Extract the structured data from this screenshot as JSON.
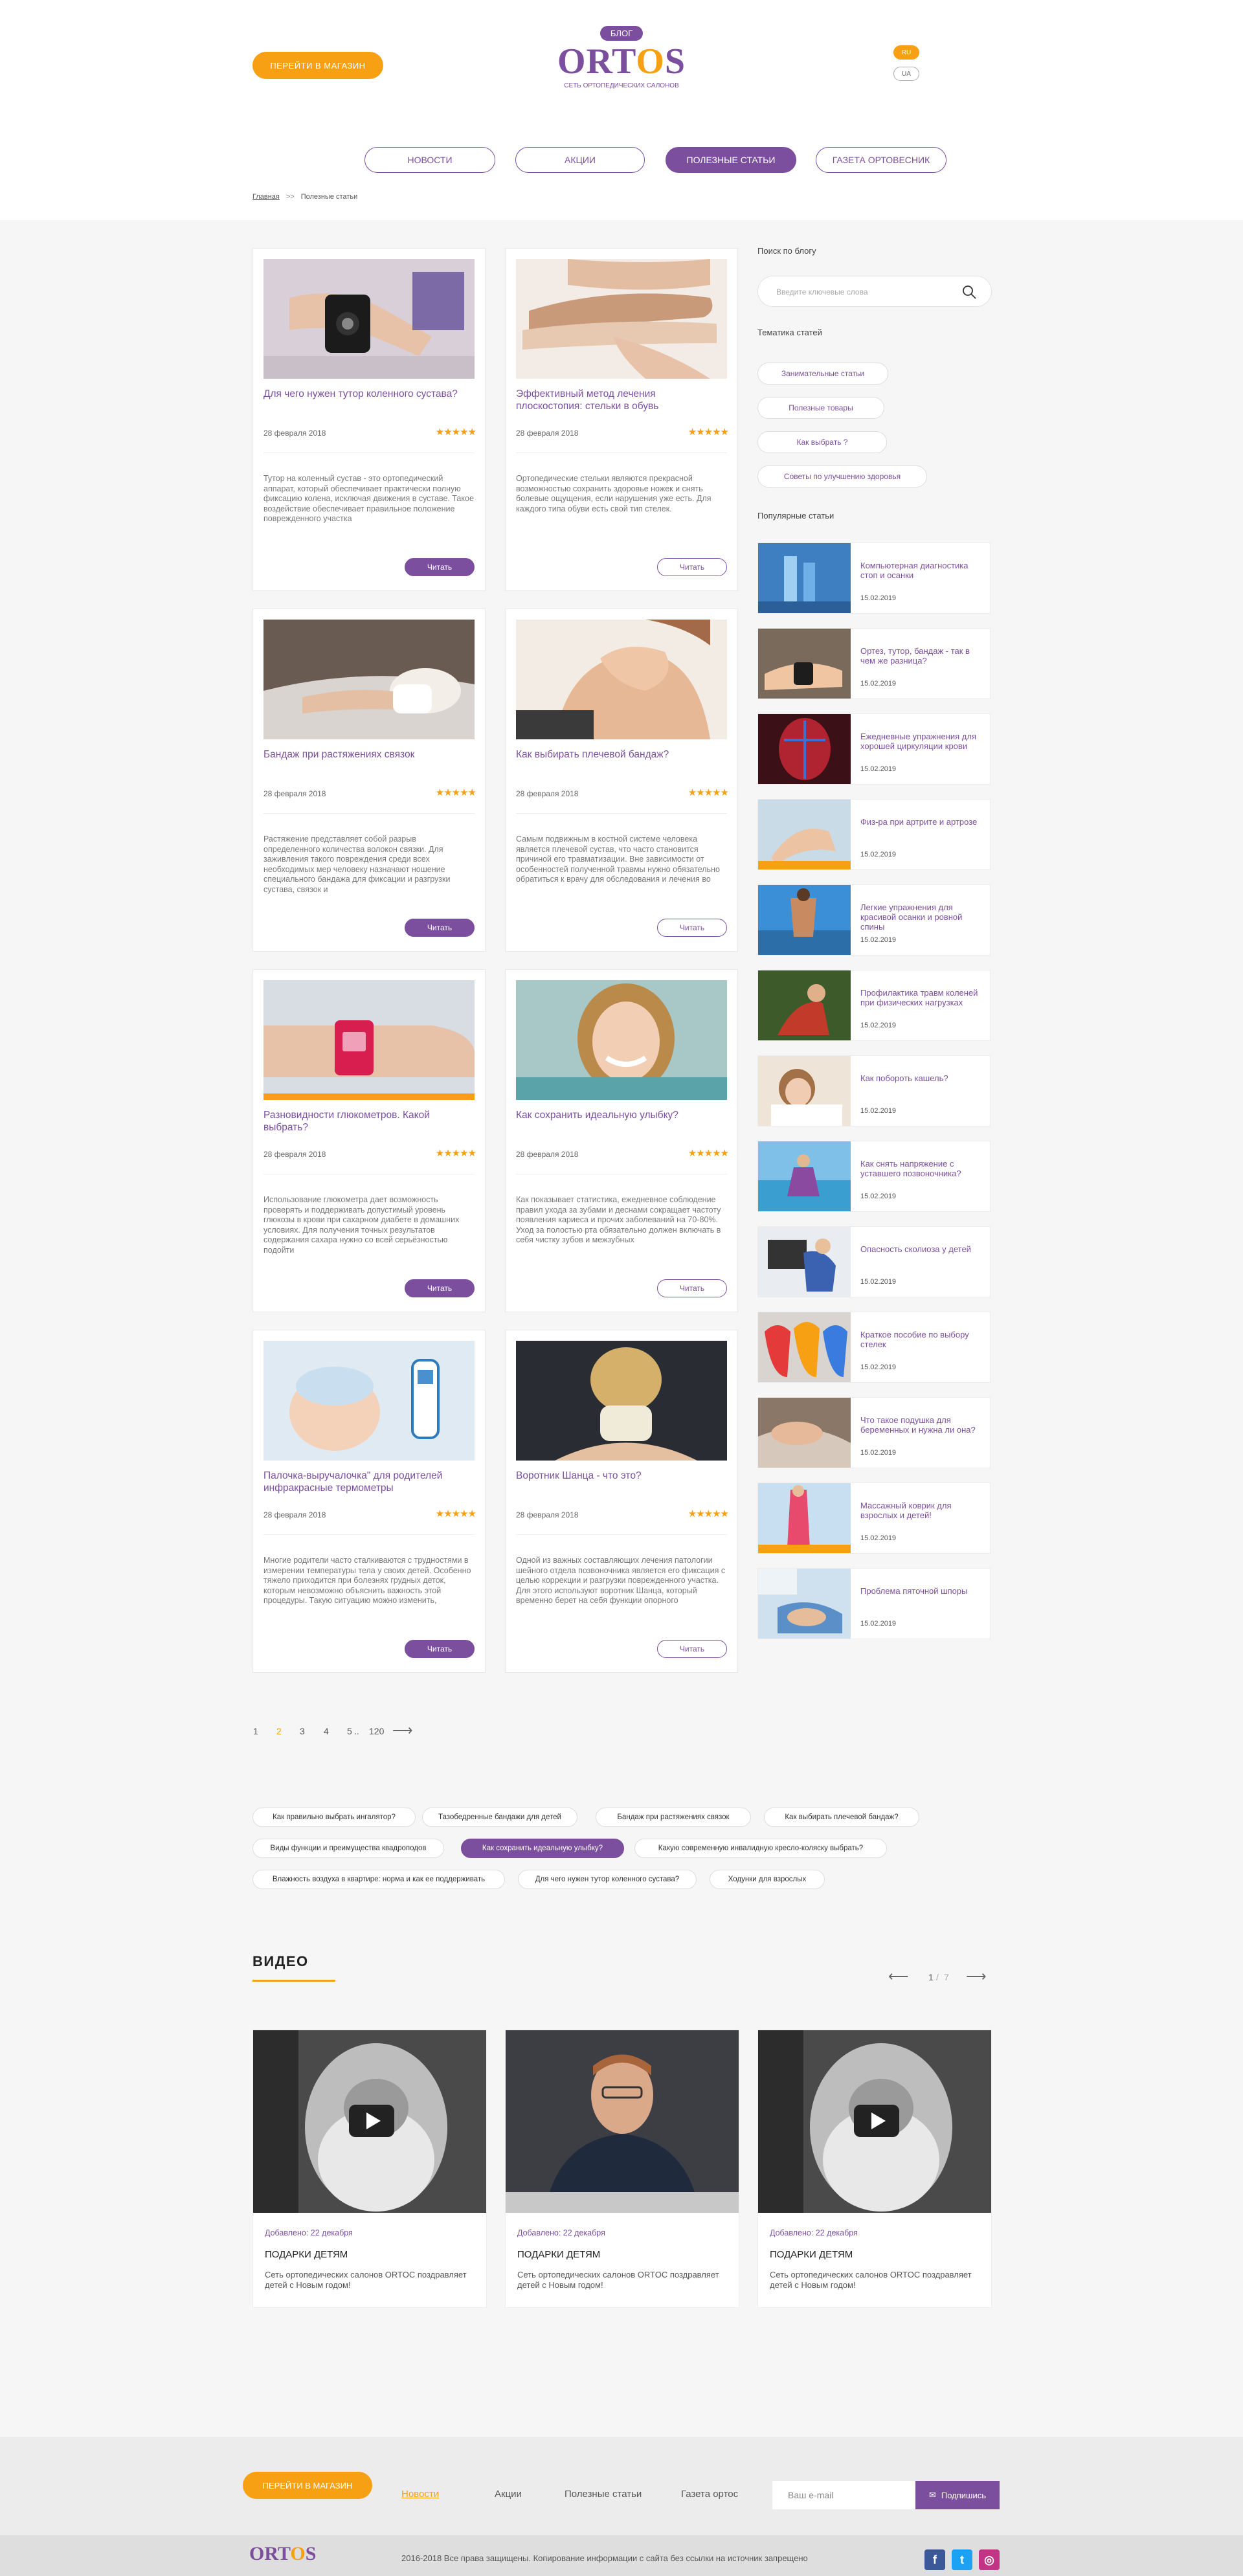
{
  "header": {
    "shop_button": "ПЕРЕЙТИ В МАГАЗИН",
    "logo_badge": "БЛОГ",
    "logo_word_a": "ORT",
    "logo_word_o": "O",
    "logo_word_b": "S",
    "logo_subtitle": "СЕТЬ ОРТОПЕДИЧЕСКИХ САЛОНОВ",
    "lang_ru": "RU",
    "lang_ua": "UA",
    "nav": [
      "НОВОСТИ",
      "АКЦИИ",
      "ПОЛЕЗНЫЕ СТАТЬИ",
      "ГАЗЕТА ОРТОВЕСНИК"
    ],
    "active_nav": "ПОЛЕЗНЫЕ СТАТЬИ"
  },
  "breadcrumb": {
    "home": "Главная",
    "sep": ">>",
    "current": "Полезные статьи"
  },
  "articles": [
    {
      "title": "Для чего нужен тутор коленного сустава?",
      "date": "28 февраля 2018",
      "stars": "★★★★★",
      "text": "Тутор на коленный сустав - это ортопедический аппарат, который обеспечивает практически полную фиксацию колена, исключая движения в суставе. Такое воздействие обеспечивает правильное положение поврежденного участка",
      "read": "Читать",
      "read_style": "filled"
    },
    {
      "title": "Эффективный метод лечения плоскостопия: стельки в обувь",
      "date": "28 февраля 2018",
      "stars": "★★★★★",
      "text": "Ортопедические стельки являются прекрасной возможностью сохранить здоровье ножек и снять болевые ощущения, если нарушения уже есть. Для каждого типа обуви есть свой тип стелек.",
      "read": "Читать",
      "read_style": "outline"
    },
    {
      "title": "Бандаж при растяжениях связок",
      "date": "28 февраля 2018",
      "stars": "★★★★★",
      "text": "Растяжение представляет собой разрыв определенного количества волокон связки. Для заживления такого повреждения среди всех необходимых мер человеку назначают ношение специального бандажа для фиксации и разгрузки сустава, связок и",
      "read": "Читать",
      "read_style": "filled"
    },
    {
      "title": "Как выбирать плечевой бандаж?",
      "date": "28 февраля 2018",
      "stars": "★★★★★",
      "text": "Самым подвижным в костной системе человека является плечевой сустав, что часто становится причиной его травматизации. Вне зависимости от особенностей полученной травмы нужно обязательно обратиться к врачу для обследования и лечения во",
      "read": "Читать",
      "read_style": "outline"
    },
    {
      "title": "Разновидности глюкометров. Какой выбрать?",
      "date": "28 февраля 2018",
      "stars": "★★★★★",
      "text": "Использование глюкометра дает возможность проверять и поддерживать допустимый уровень глюкозы в крови при сахарном диабете в домашних условиях. Для получения точных результатов содержания сахара нужно со всей серьёзностью подойти",
      "read": "Читать",
      "read_style": "filled"
    },
    {
      "title": "Как сохранить идеальную улыбку?",
      "date": "28 февраля 2018",
      "stars": "★★★★★",
      "text": "Как показывает статистика, ежедневное соблюдение правил ухода за зубами и деснами сокращает частоту появления кариеса и прочих заболеваний на 70-80%. Уход за полостью рта обязательно должен включать в себя чистку зубов и межзубных",
      "read": "Читать",
      "read_style": "outline"
    },
    {
      "title": "Палочка-выручалочка\" для родителей инфракрасные термометры",
      "date": "28 февраля 2018",
      "stars": "★★★★★",
      "text": "Многие родители часто сталкиваются с трудностями в измерении температуры тела у своих детей. Особенно тяжело приходится при болезнях грудных деток, которым невозможно объяснить важность этой процедуры. Такую ситуацию можно изменить,",
      "read": "Читать",
      "read_style": "filled"
    },
    {
      "title": "Воротник Шанца - что это?",
      "date": "28 февраля 2018",
      "stars": "★★★★★",
      "text": "Одной из важных составляющих лечения патологии шейного отдела позвоночника является его фиксация с целью коррекции и разгрузки поврежденного участка. Для этого используют воротник Шанца, который временно берет на себя функции опорного",
      "read": "Читать",
      "read_style": "outline"
    }
  ],
  "sidebar": {
    "search_heading": "Поиск по блогу",
    "search_placeholder": "Введите ключевые слова",
    "topics_heading": "Тематика статей",
    "topics": [
      "Занимательные статьи",
      "Полезные товары",
      "Как выбрать ?",
      "Советы по улучшению здоровья"
    ],
    "popular_heading": "Популярные статьи",
    "popular": [
      {
        "title": "Компьютерная диагностика стоп и осанки",
        "date": "15.02.2019"
      },
      {
        "title": "Ортез, тутор, бандаж - так в чем же разница?",
        "date": "15.02.2019"
      },
      {
        "title": "Ежедневные упражнения для хорошей циркуляции крови",
        "date": "15.02.2019"
      },
      {
        "title": "Физ-ра при артрите и артрозе",
        "date": "15.02.2019"
      },
      {
        "title": "Легкие упражнения для красивой осанки и ровной спины",
        "date": "15.02.2019"
      },
      {
        "title": "Профилактика травм коленей при физических нагрузках",
        "date": "15.02.2019"
      },
      {
        "title": "Как побороть кашель?",
        "date": "15.02.2019"
      },
      {
        "title": "Как снять напряжение с уставшего позвоночника?",
        "date": "15.02.2019"
      },
      {
        "title": "Опасность сколиоза у детей",
        "date": "15.02.2019"
      },
      {
        "title": "Краткое пособие по выбору стелек",
        "date": "15.02.2019"
      },
      {
        "title": "Что такое подушка для беременных и нужна ли она?",
        "date": "15.02.2019"
      },
      {
        "title": "Массажный коврик для взрослых и детей!",
        "date": "15.02.2019"
      },
      {
        "title": "Проблема пяточной шпоры",
        "date": "15.02.2019"
      }
    ]
  },
  "pagination": {
    "pages": [
      "1",
      "2",
      "3",
      "4",
      "5",
      "..",
      "120"
    ],
    "current": "2",
    "next_arrow": "⟶"
  },
  "footer_tags": [
    "Как правильно выбрать ингалятор?",
    "Тазобедренные бандажи для детей",
    "Бандаж при растяжениях связок",
    "Как выбирать плечевой бандаж?",
    "Виды функции и преимущества квадроподов",
    "Как сохранить идеальную улыбку?",
    "Какую современную инвалидную кресло-коляску выбрать?",
    "Влажность воздуха в квартире: норма и как ее поддерживать",
    "Для чего нужен тутор коленного сустава?",
    "Ходунки для взрослых"
  ],
  "active_footer_tag": "Как сохранить идеальную улыбку?",
  "video": {
    "heading": "ВИДЕО",
    "pager_current": "1",
    "pager_sep": "/",
    "pager_total": "7",
    "prev_arrow": "⟵",
    "next_arrow": "⟶",
    "items": [
      {
        "date": "Добавлено: 22 декабря",
        "title": "ПОДАРКИ ДЕТЯМ",
        "text": "Сеть ортопедических салонов ORTOC поздравляет детей с Новым годом!"
      },
      {
        "date": "Добавлено: 22 декабря",
        "title": "ПОДАРКИ ДЕТЯМ",
        "text": "Сеть ортопедических салонов ORTOC поздравляет детей с Новым годом!"
      },
      {
        "date": "Добавлено: 22 декабря",
        "title": "ПОДАРКИ ДЕТЯМ",
        "text": "Сеть ортопедических салонов ORTOC поздравляет детей с Новым годом!"
      }
    ]
  },
  "footer": {
    "shop_button": "ПЕРЕЙТИ В МАГАЗИН",
    "links": [
      "Новости",
      "Акции",
      "Полезные статьи",
      "Газета ортос"
    ],
    "active_link": "Новости",
    "email_placeholder": "Ваш e-mail",
    "subscribe": "Подпишись",
    "logo_a": "ORT",
    "logo_o": "O",
    "logo_b": "S",
    "copyright": "2016-2018   Все права защищены. Копирование информации с сайта без ссылки на источник запрещено",
    "social": [
      "f",
      "t",
      "◎"
    ]
  },
  "colors": {
    "brand": "#7b4f9d",
    "accent": "#f7a014"
  }
}
